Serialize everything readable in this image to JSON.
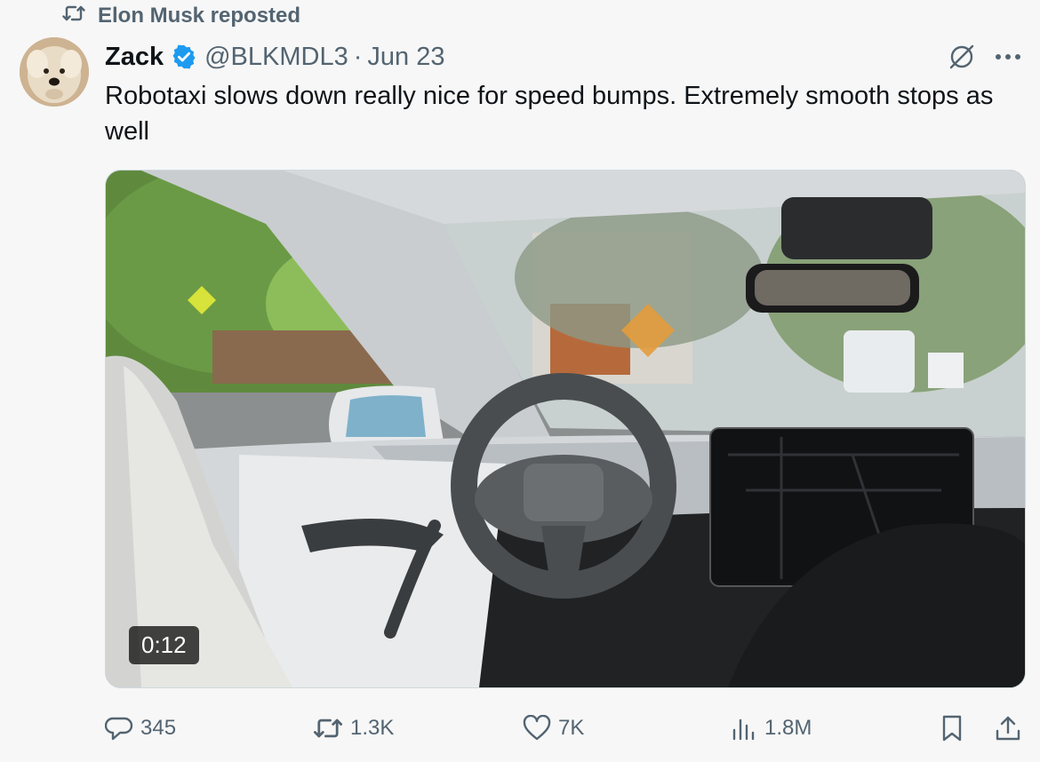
{
  "repost": {
    "text": "Elon Musk reposted"
  },
  "author": {
    "name": "Zack",
    "handle": "@BLKMDL3",
    "separator": "·",
    "date": "Jun 23",
    "verified": true
  },
  "tweet": {
    "text": "Robotaxi slows down really nice for speed bumps. Extremely smooth stops as well"
  },
  "media": {
    "type": "video",
    "duration": "0:12"
  },
  "actions": {
    "replies": "345",
    "reposts": "1.3K",
    "likes": "7K",
    "views": "1.8M"
  },
  "icons": {
    "repost": "repost-icon",
    "verified": "verified-badge-icon",
    "grok": "grok-icon",
    "more": "more-icon",
    "reply": "reply-icon",
    "like": "heart-icon",
    "views": "views-chart-icon",
    "bookmark": "bookmark-icon",
    "share": "share-icon"
  },
  "colors": {
    "verified": "#1d9bf0",
    "secondary_text": "#536471",
    "primary_text": "#0f1419",
    "background": "#f7f7f7"
  }
}
